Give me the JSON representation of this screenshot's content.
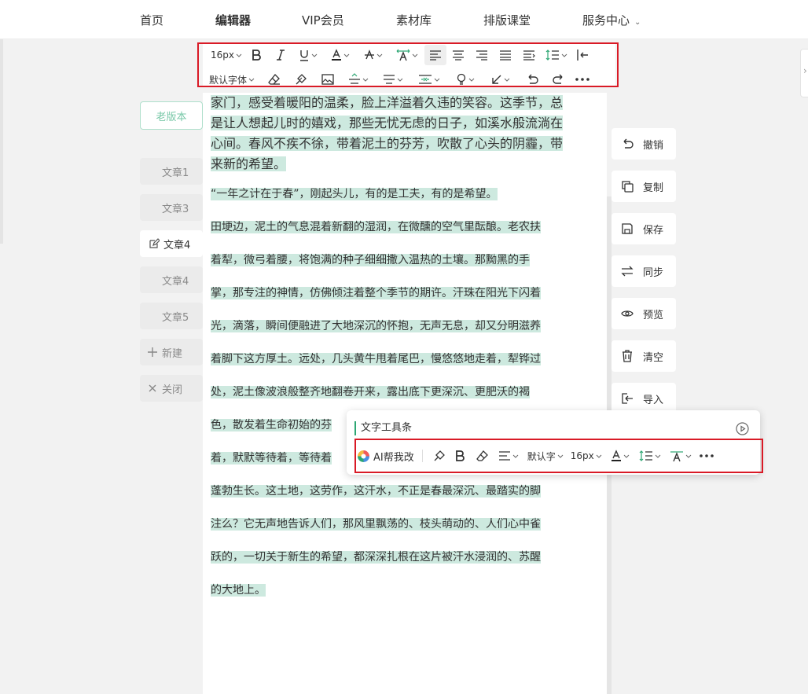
{
  "nav": {
    "items": [
      "首页",
      "编辑器",
      "VIP会员",
      "素材库",
      "排版课堂",
      "服务中心"
    ],
    "active_index": 1
  },
  "sidebar": {
    "old_version": "老版本",
    "docs": [
      "文章1",
      "文章3",
      "文章4",
      "文章4",
      "文章5"
    ],
    "active_doc_index": 2,
    "new_label": "新建",
    "close_label": "关闭"
  },
  "toolbar": {
    "font_size": "16px",
    "font_family": "默认字体"
  },
  "content": {
    "para1_lines": [
      "家门，感受着暖阳的温柔，脸上洋溢着久违的笑容。这季节，总",
      "是让人想起儿时的嬉戏，那些无忧无虑的日子，如溪水般流淌在",
      "心间。春风不疾不徐，带着泥土的芬芳，吹散了心头的阴霾，带",
      "来新的希望。"
    ],
    "para2_lines": [
      "“一年之计在于春”，刚起头儿，有的是工夫，有的是希望。",
      "田埂边，泥土的气息混着新翻的湿润，在微醺的空气里酝酿。老农扶",
      "着犁，微弓着腰，将饱满的种子细细撒入温热的土壤。那黝黑的手",
      "掌，那专注的神情，仿佛倾注着整个季节的期许。汗珠在阳光下闪着",
      "光，滴落，瞬间便融进了大地深沉的怀抱，无声无息，却又分明滋养",
      "着脚下这方厚土。远处，几头黄牛甩着尾巴，慢悠悠地走着，犁铧过",
      "处，泥土像波浪般整齐地翻卷开来，露出底下更深沉、更肥沃的褐",
      "色，散发着生命初始的芬",
      "着，默默等待着，等待着",
      "蓬勃生长。这土地，这劳作，这汗水，不正是春最深沉、最踏实的脚",
      "注么？它无声地告诉人们，那风里飘荡的、枝头萌动的、人们心中雀",
      "跃的，一切关于新生的希望，都深深扎根在这片被汗水浸润的、苏醒",
      "的大地上。"
    ]
  },
  "side_actions": [
    "撤销",
    "复制",
    "保存",
    "同步",
    "预览",
    "清空",
    "导入"
  ],
  "float_toolbar": {
    "title": "文字工具条",
    "ai_label": "AI帮我改",
    "font_family": "默认字",
    "font_size": "16px"
  },
  "colors": {
    "highlight": "#cde9df",
    "accent": "#2da673",
    "annotation_box": "#d91a26"
  }
}
